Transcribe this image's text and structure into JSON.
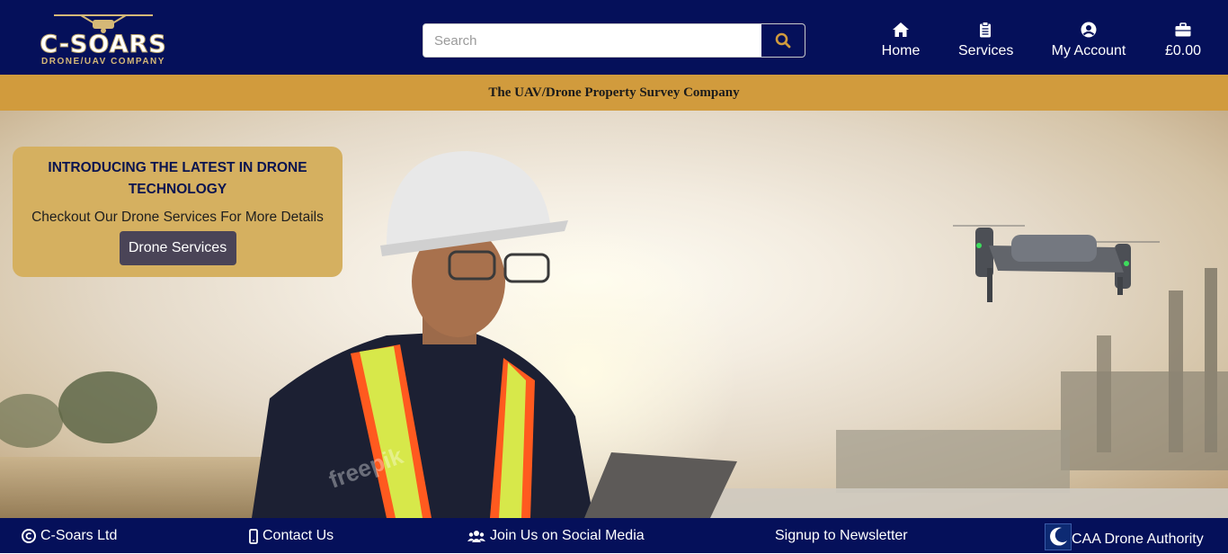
{
  "brand": {
    "name": "C-SOARS",
    "tagline": "DRONE/UAV COMPANY"
  },
  "search": {
    "placeholder": "Search",
    "value": ""
  },
  "nav": {
    "home": "Home",
    "services": "Services",
    "account": "My Account",
    "cart": "£0.00"
  },
  "strip": {
    "text": "The UAV/Drone Property Survey Company"
  },
  "promo": {
    "title": "INTRODUCING THE LATEST IN DRONE TECHNOLOGY",
    "text": "Checkout Our Drone Services For More Details",
    "button": "Drone Services"
  },
  "hero": {
    "watermark": "freepik"
  },
  "footer": {
    "copyright": "C-Soars Ltd",
    "contact": "Contact Us",
    "social": "Join Us on Social Media",
    "newsletter": "Signup to Newsletter",
    "caa": "CAA Drone Authority"
  },
  "colors": {
    "navy": "#05105a",
    "gold": "#d19b3d",
    "promo_bg": "#d5b060",
    "button_bg": "#4a4457"
  }
}
